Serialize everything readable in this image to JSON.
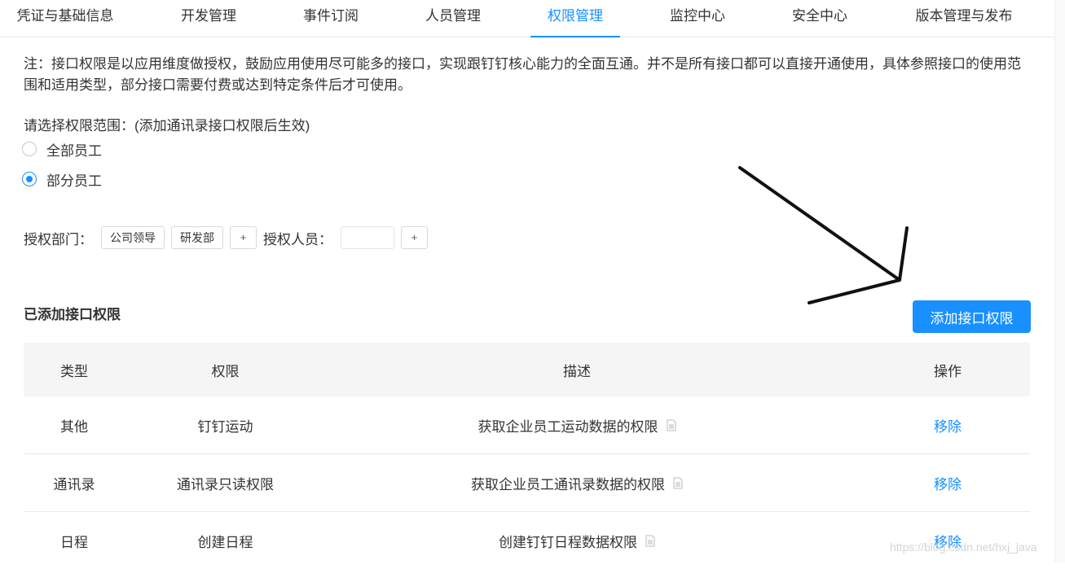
{
  "tabs": [
    {
      "label": "凭证与基础信息"
    },
    {
      "label": "开发管理"
    },
    {
      "label": "事件订阅"
    },
    {
      "label": "人员管理"
    },
    {
      "label": "权限管理",
      "active": true
    },
    {
      "label": "监控中心"
    },
    {
      "label": "安全中心"
    },
    {
      "label": "版本管理与发布"
    }
  ],
  "notice": "注：接口权限是以应用维度做授权，鼓励应用使用尽可能多的接口，实现跟钉钉核心能力的全面互通。并不是所有接口都可以直接开通使用，具体参照接口的使用范围和适用类型，部分接口需要付费或达到特定条件后才可使用。",
  "scope": {
    "label": "请选择权限范围：(添加通讯录接口权限后生效)",
    "options": [
      {
        "label": "全部员工",
        "checked": false
      },
      {
        "label": "部分员工",
        "checked": true
      }
    ]
  },
  "auth": {
    "dept_label": "授权部门：",
    "departments": [
      "公司领导",
      "研发部"
    ],
    "plus": "+",
    "user_label": "授权人员："
  },
  "section": {
    "title": "已添加接口权限",
    "add_button": "添加接口权限"
  },
  "table": {
    "headers": [
      "类型",
      "权限",
      "描述",
      "操作"
    ],
    "rows": [
      {
        "type": "其他",
        "permission": "钉钉运动",
        "description": "获取企业员工运动数据的权限",
        "action": "移除"
      },
      {
        "type": "通讯录",
        "permission": "通讯录只读权限",
        "description": "获取企业员工通讯录数据的权限",
        "action": "移除"
      },
      {
        "type": "日程",
        "permission": "创建日程",
        "description": "创建钉钉日程数据权限",
        "action": "移除"
      }
    ]
  },
  "icons": {
    "description_doc": "document-icon",
    "annotation": "arrow-annotation"
  },
  "watermark": "https://blog.csdn.net/hxj_java",
  "colors": {
    "accent": "#1890ff",
    "header_bg": "#f5f5f5"
  }
}
